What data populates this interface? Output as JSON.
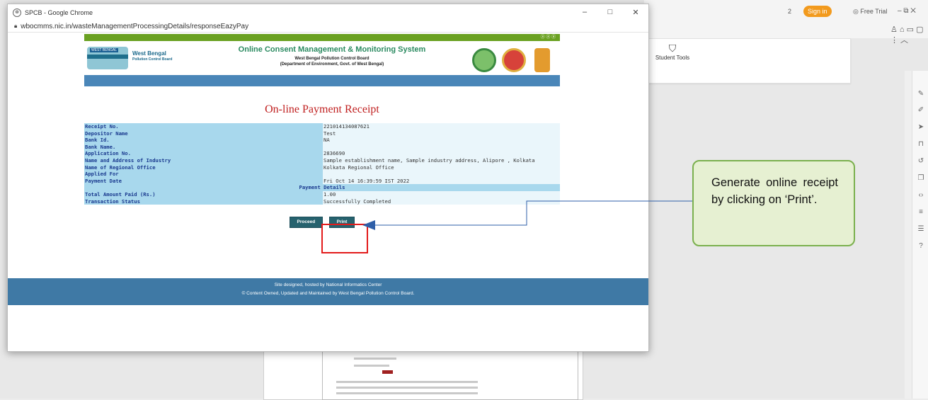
{
  "browser": {
    "tab_title": "SPCB - Google Chrome",
    "url": "wbocmms.nic.in/wasteManagementProcessingDetails/responseEazyPay",
    "controls": {
      "minimize": "–",
      "maximize": "□",
      "close": "✕"
    }
  },
  "background_app": {
    "ribbon_item": "Student Tools",
    "sign_in": "Sign in",
    "free_trial": "Free Trial",
    "page_count": "2"
  },
  "site": {
    "greenbar_icons": "ⓐ ⓐ ⓐ",
    "org_logo_label": "WEST BENGAL",
    "org_name": "West Bengal",
    "org_sub": "Pollution Control Board",
    "system_title": "Online Consent Management & Monitoring System",
    "system_sub1": "West Bengal Pollution Control Board",
    "system_sub2": "(Department of Environment, Govt. of West Bengal)"
  },
  "receipt": {
    "title": "On-line Payment Receipt",
    "rows": [
      {
        "label": "Receipt No.",
        "value": "221014134087621"
      },
      {
        "label": "Depositor Name",
        "value": "Test"
      },
      {
        "label": "Bank Id.",
        "value": "NA"
      },
      {
        "label": "Bank Name.",
        "value": ""
      },
      {
        "label": "Application No.",
        "value": "2836690"
      },
      {
        "label": "Name and Address of Industry",
        "value": "Sample establishment name, Sample industry address, Alipore , Kolkata"
      },
      {
        "label": "Name of Regional Office",
        "value": "Kolkata Regional Office"
      },
      {
        "label": "Applied For",
        "value": ""
      },
      {
        "label": "Payment Date",
        "value": "Fri Oct 14 16:39:59 IST 2022"
      }
    ],
    "section_heading": "Payment Details",
    "payment_rows": [
      {
        "label": "Total Amount Paid (Rs.)",
        "value": "1.00"
      },
      {
        "label": "Transaction Status",
        "value": "Successfully Completed"
      }
    ],
    "proceed_label": "Proceed",
    "print_label": "Print"
  },
  "footer": {
    "line1": "Site designed, hosted by National Informatics Center",
    "line2": "© Content Owned, Updated and Maintained by West Bengal Pollution Control Board."
  },
  "annotation": {
    "callout_text": "Generate online receipt by clicking on ‘Print’.",
    "highlight_color": "#e31b1b",
    "callout_border_color": "#7bb04e",
    "connector_color": "#2f5fa8"
  }
}
